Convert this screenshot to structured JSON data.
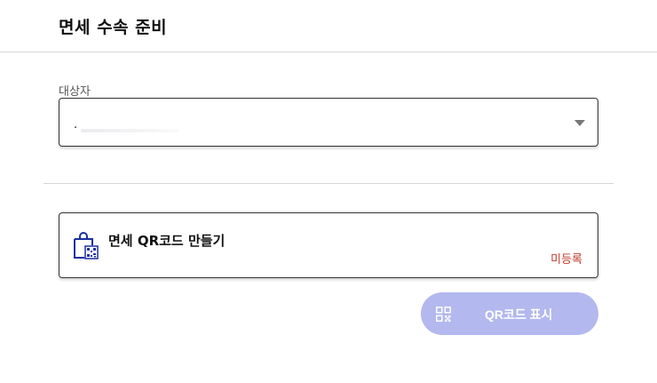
{
  "header": {
    "title": "면세 수속 준비"
  },
  "target": {
    "label": "대상자",
    "selected_value": ".",
    "icon": "caret-down-icon"
  },
  "qr_card": {
    "title": "면세 QR코드 만들기",
    "status": "미등록",
    "icon": "shopping-bag-qr-icon",
    "status_color": "#c0392b",
    "icon_color": "#1a2fa0"
  },
  "qr_button": {
    "label": "QR코드 표시",
    "icon": "qr-code-icon",
    "background": "#b3b8ee"
  }
}
